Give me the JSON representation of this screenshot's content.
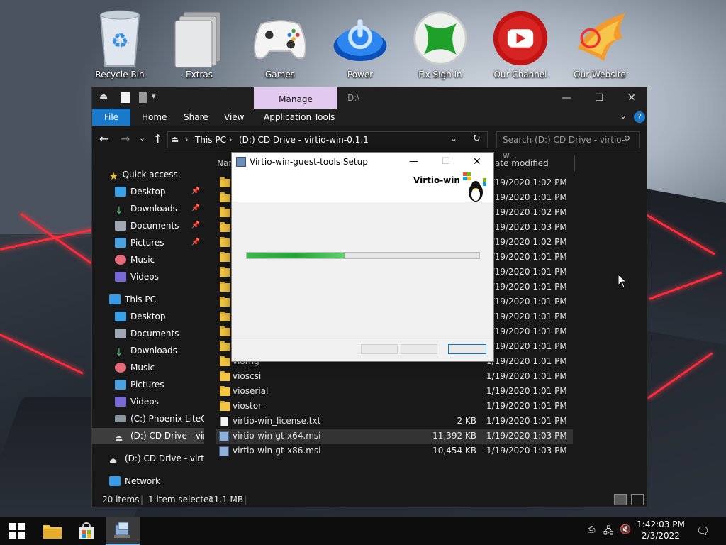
{
  "desktop": {
    "icons": [
      {
        "label": "Recycle Bin",
        "icon": "recycle-bin-icon"
      },
      {
        "label": "Extras",
        "icon": "folder-stack-icon"
      },
      {
        "label": "Games",
        "icon": "gamepad-icon"
      },
      {
        "label": "Power",
        "icon": "power-icon"
      },
      {
        "label": "Fix Sign In",
        "icon": "xbox-icon"
      },
      {
        "label": "Our Channel",
        "icon": "youtube-icon"
      },
      {
        "label": "Our Website",
        "icon": "phoenix-icon"
      }
    ]
  },
  "explorer": {
    "manage_tab": "Manage",
    "title_path": "D:\\",
    "ribbon_tabs": [
      "File",
      "Home",
      "Share",
      "View",
      "Application Tools"
    ],
    "address": {
      "segments": [
        "This PC",
        "(D:) CD Drive - virtio-win-0.1.1"
      ]
    },
    "search_placeholder": "Search (D:) CD Drive - virtio-w...",
    "nav": {
      "quick_access": "Quick access",
      "quick_items": [
        "Desktop",
        "Downloads",
        "Documents",
        "Pictures",
        "Music",
        "Videos"
      ],
      "this_pc": "This PC",
      "pc_items": [
        "Desktop",
        "Documents",
        "Downloads",
        "Music",
        "Pictures",
        "Videos",
        "(C:) Phoenix LiteOS",
        "(D:) CD Drive - virtio"
      ],
      "cd_drive": "(D:) CD Drive - virtio-",
      "network": "Network"
    },
    "columns": {
      "name": "Nam",
      "date": "ate modified"
    },
    "files": [
      {
        "name": "",
        "size": "",
        "date": "1/19/2020 1:02 PM",
        "type": "folder"
      },
      {
        "name": "",
        "size": "",
        "date": "1/19/2020 1:01 PM",
        "type": "folder"
      },
      {
        "name": "",
        "size": "",
        "date": "1/19/2020 1:02 PM",
        "type": "folder"
      },
      {
        "name": "",
        "size": "",
        "date": "1/19/2020 1:03 PM",
        "type": "folder"
      },
      {
        "name": "",
        "size": "",
        "date": "1/19/2020 1:02 PM",
        "type": "folder"
      },
      {
        "name": "",
        "size": "",
        "date": "1/19/2020 1:01 PM",
        "type": "folder"
      },
      {
        "name": "",
        "size": "",
        "date": "1/19/2020 1:01 PM",
        "type": "folder"
      },
      {
        "name": "",
        "size": "",
        "date": "1/19/2020 1:01 PM",
        "type": "folder"
      },
      {
        "name": "",
        "size": "",
        "date": "1/19/2020 1:01 PM",
        "type": "folder"
      },
      {
        "name": "",
        "size": "",
        "date": "1/19/2020 1:01 PM",
        "type": "folder"
      },
      {
        "name": "",
        "size": "",
        "date": "1/19/2020 1:01 PM",
        "type": "folder"
      },
      {
        "name": "viohput",
        "size": "",
        "date": "1/19/2020 1:01 PM",
        "type": "folder"
      },
      {
        "name": "viorng",
        "size": "",
        "date": "1/19/2020 1:01 PM",
        "type": "folder"
      },
      {
        "name": "vioscsi",
        "size": "",
        "date": "1/19/2020 1:01 PM",
        "type": "folder"
      },
      {
        "name": "vioserial",
        "size": "",
        "date": "1/19/2020 1:01 PM",
        "type": "folder"
      },
      {
        "name": "viostor",
        "size": "",
        "date": "1/19/2020 1:01 PM",
        "type": "folder"
      },
      {
        "name": "virtio-win_license.txt",
        "size": "2 KB",
        "date": "1/19/2020 1:01 PM",
        "type": "txt"
      },
      {
        "name": "virtio-win-gt-x64.msi",
        "size": "11,392 KB",
        "date": "1/19/2020 1:03 PM",
        "type": "msi",
        "selected": true
      },
      {
        "name": "virtio-win-gt-x86.msi",
        "size": "10,454 KB",
        "date": "1/19/2020 1:03 PM",
        "type": "msi"
      }
    ],
    "status": {
      "items": "20 items",
      "selected": "1 item selected",
      "size": "11.1 MB"
    }
  },
  "setup": {
    "title": "Virtio-win-guest-tools Setup",
    "brand": "Virtio-win",
    "progress": 0.42
  },
  "taskbar": {
    "time": "1:42:03 PM",
    "date": "2/3/2022"
  },
  "colors": {
    "accent": "#1979ca",
    "manage": "#e1c9f0",
    "progress": "#23a335"
  }
}
